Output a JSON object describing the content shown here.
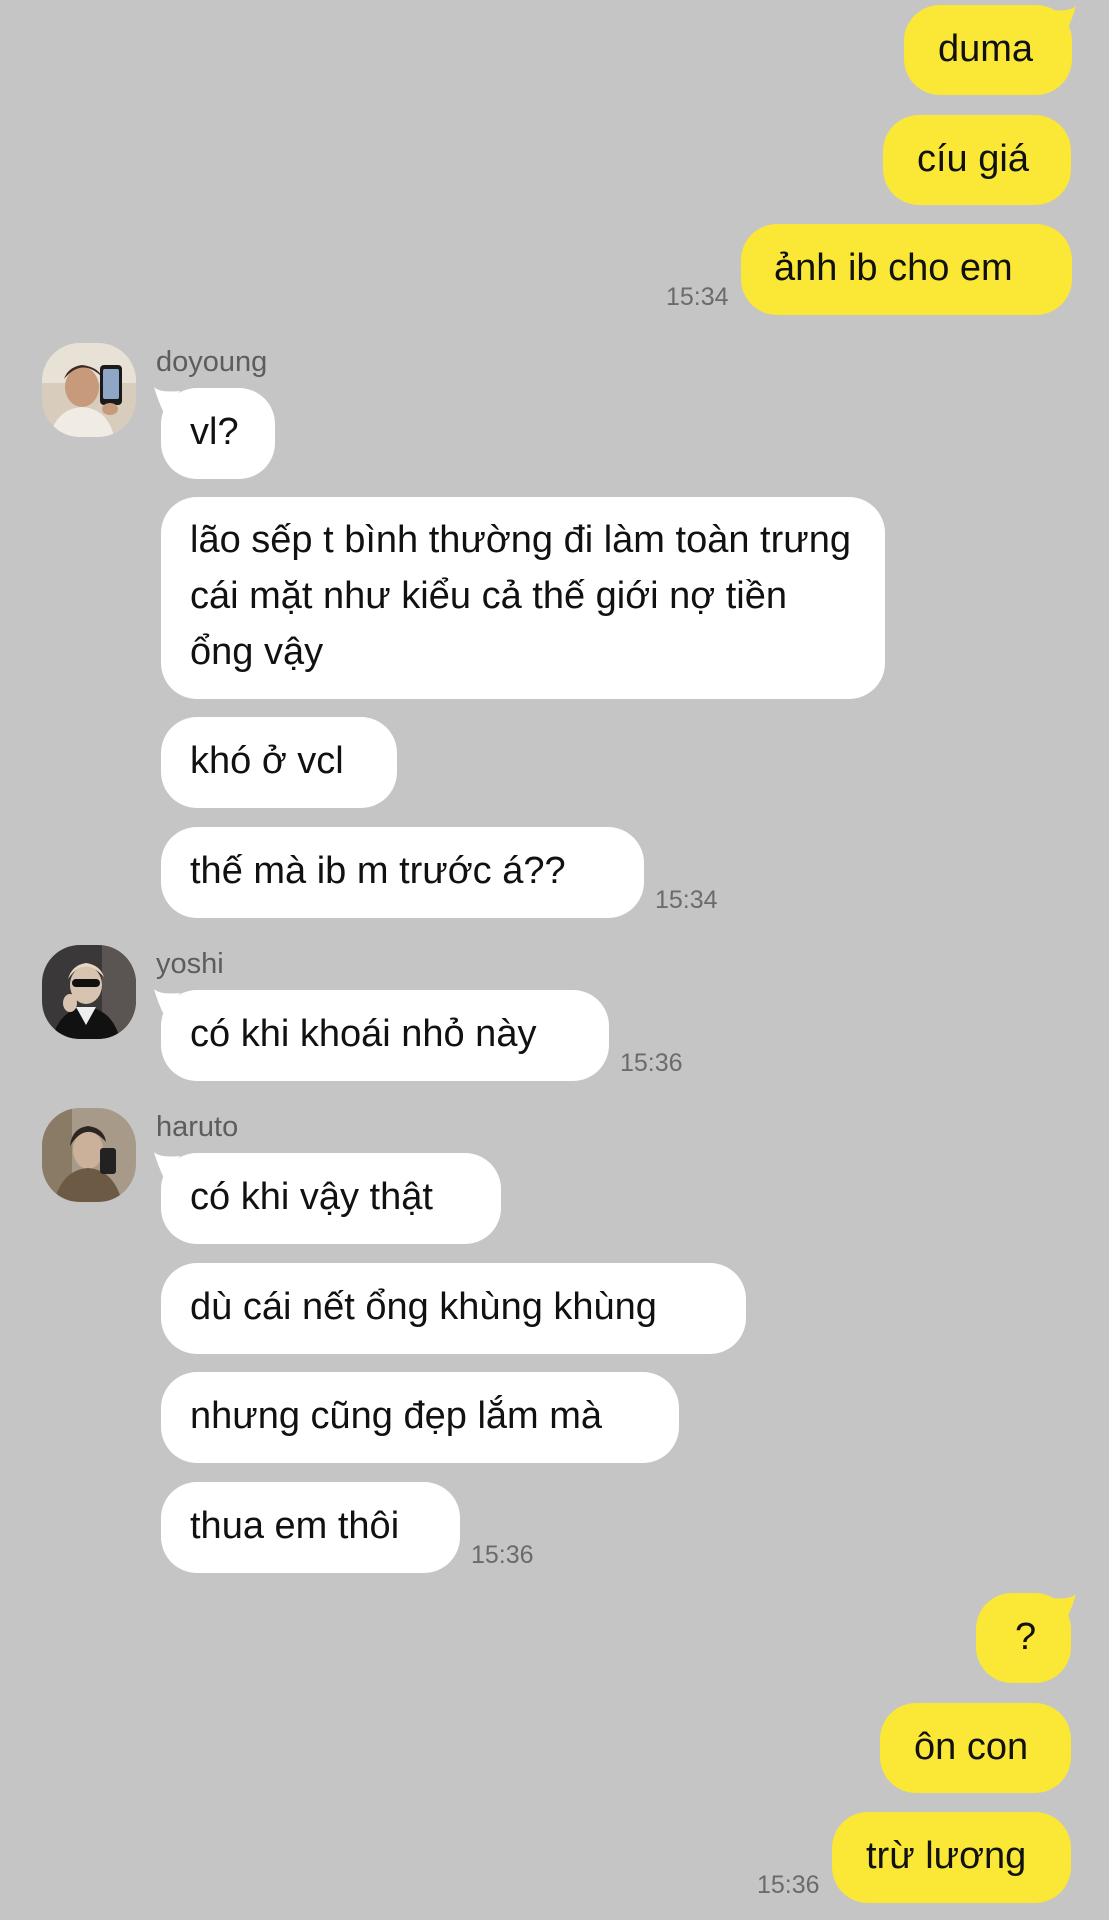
{
  "colors": {
    "background": "#c5c5c5",
    "my_bubble": "#fbe735",
    "their_bubble": "#ffffff",
    "timestamp": "#6b6b6b",
    "sender_name": "#5d5d5d"
  },
  "chat": {
    "group1": {
      "messages": [
        "duma",
        "cíu giá",
        "ảnh ib cho em"
      ],
      "time": "15:34"
    },
    "doyoung": {
      "name": "doyoung",
      "avatar_icon": "doyoung-avatar",
      "messages": [
        "vl?",
        "lão sếp t bình thường đi làm toàn trưng cái mặt như kiểu cả thế giới nợ tiền ổng vậy",
        "khó ở vcl",
        "thế mà ib m trước á??"
      ],
      "time": "15:34"
    },
    "yoshi": {
      "name": "yoshi",
      "avatar_icon": "yoshi-avatar",
      "messages": [
        "có khi khoái nhỏ này"
      ],
      "time": "15:36"
    },
    "haruto": {
      "name": "haruto",
      "avatar_icon": "haruto-avatar",
      "messages": [
        "có khi vậy thật",
        "dù cái nết ổng khùng khùng",
        "nhưng cũng đẹp lắm mà",
        "thua em thôi"
      ],
      "time": "15:36"
    },
    "group2": {
      "messages": [
        "?",
        "ôn con",
        "trừ lương"
      ],
      "time": "15:36"
    }
  }
}
